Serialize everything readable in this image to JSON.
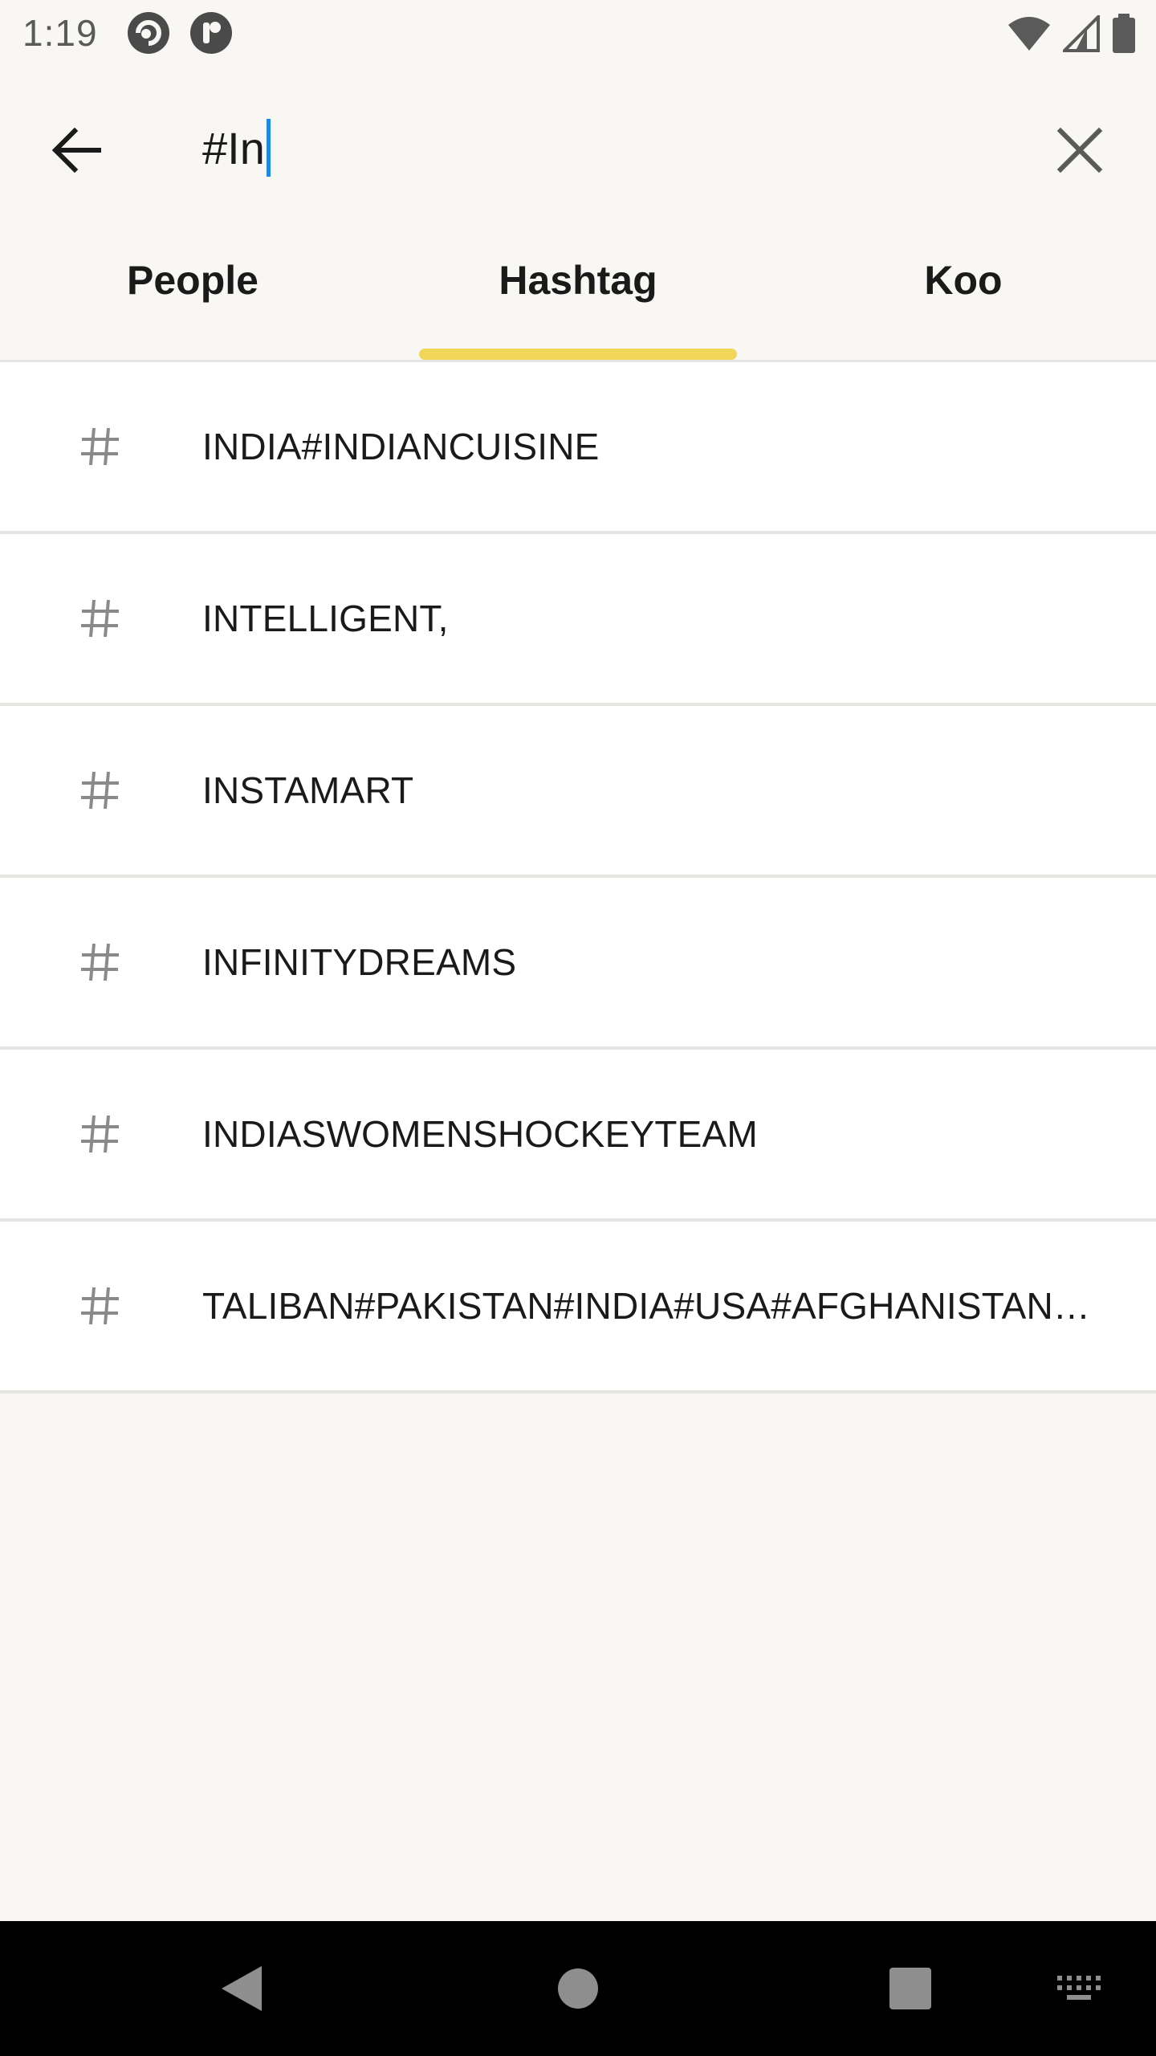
{
  "status_bar": {
    "time": "1:19"
  },
  "search": {
    "query": "#In",
    "placeholder": ""
  },
  "tabs": [
    {
      "label": "People",
      "active": false
    },
    {
      "label": "Hashtag",
      "active": true
    },
    {
      "label": "Koo",
      "active": false
    }
  ],
  "results": [
    {
      "label": "INDIA#INDIANCUISINE"
    },
    {
      "label": "INTELLIGENT,"
    },
    {
      "label": "INSTAMART"
    },
    {
      "label": "INFINITYDREAMS"
    },
    {
      "label": "INDIASWOMENSHOCKEYTEAM"
    },
    {
      "label": "TALIBAN#PAKISTAN#INDIA#USA#AFGHANISTAN#CHINA"
    }
  ],
  "colors": {
    "accent": "#f2d65c",
    "caret": "#1e88e5",
    "background": "#f8f7f4"
  },
  "icons": {
    "back": "arrow-left-icon",
    "clear": "close-icon",
    "result": "hash-icon"
  }
}
